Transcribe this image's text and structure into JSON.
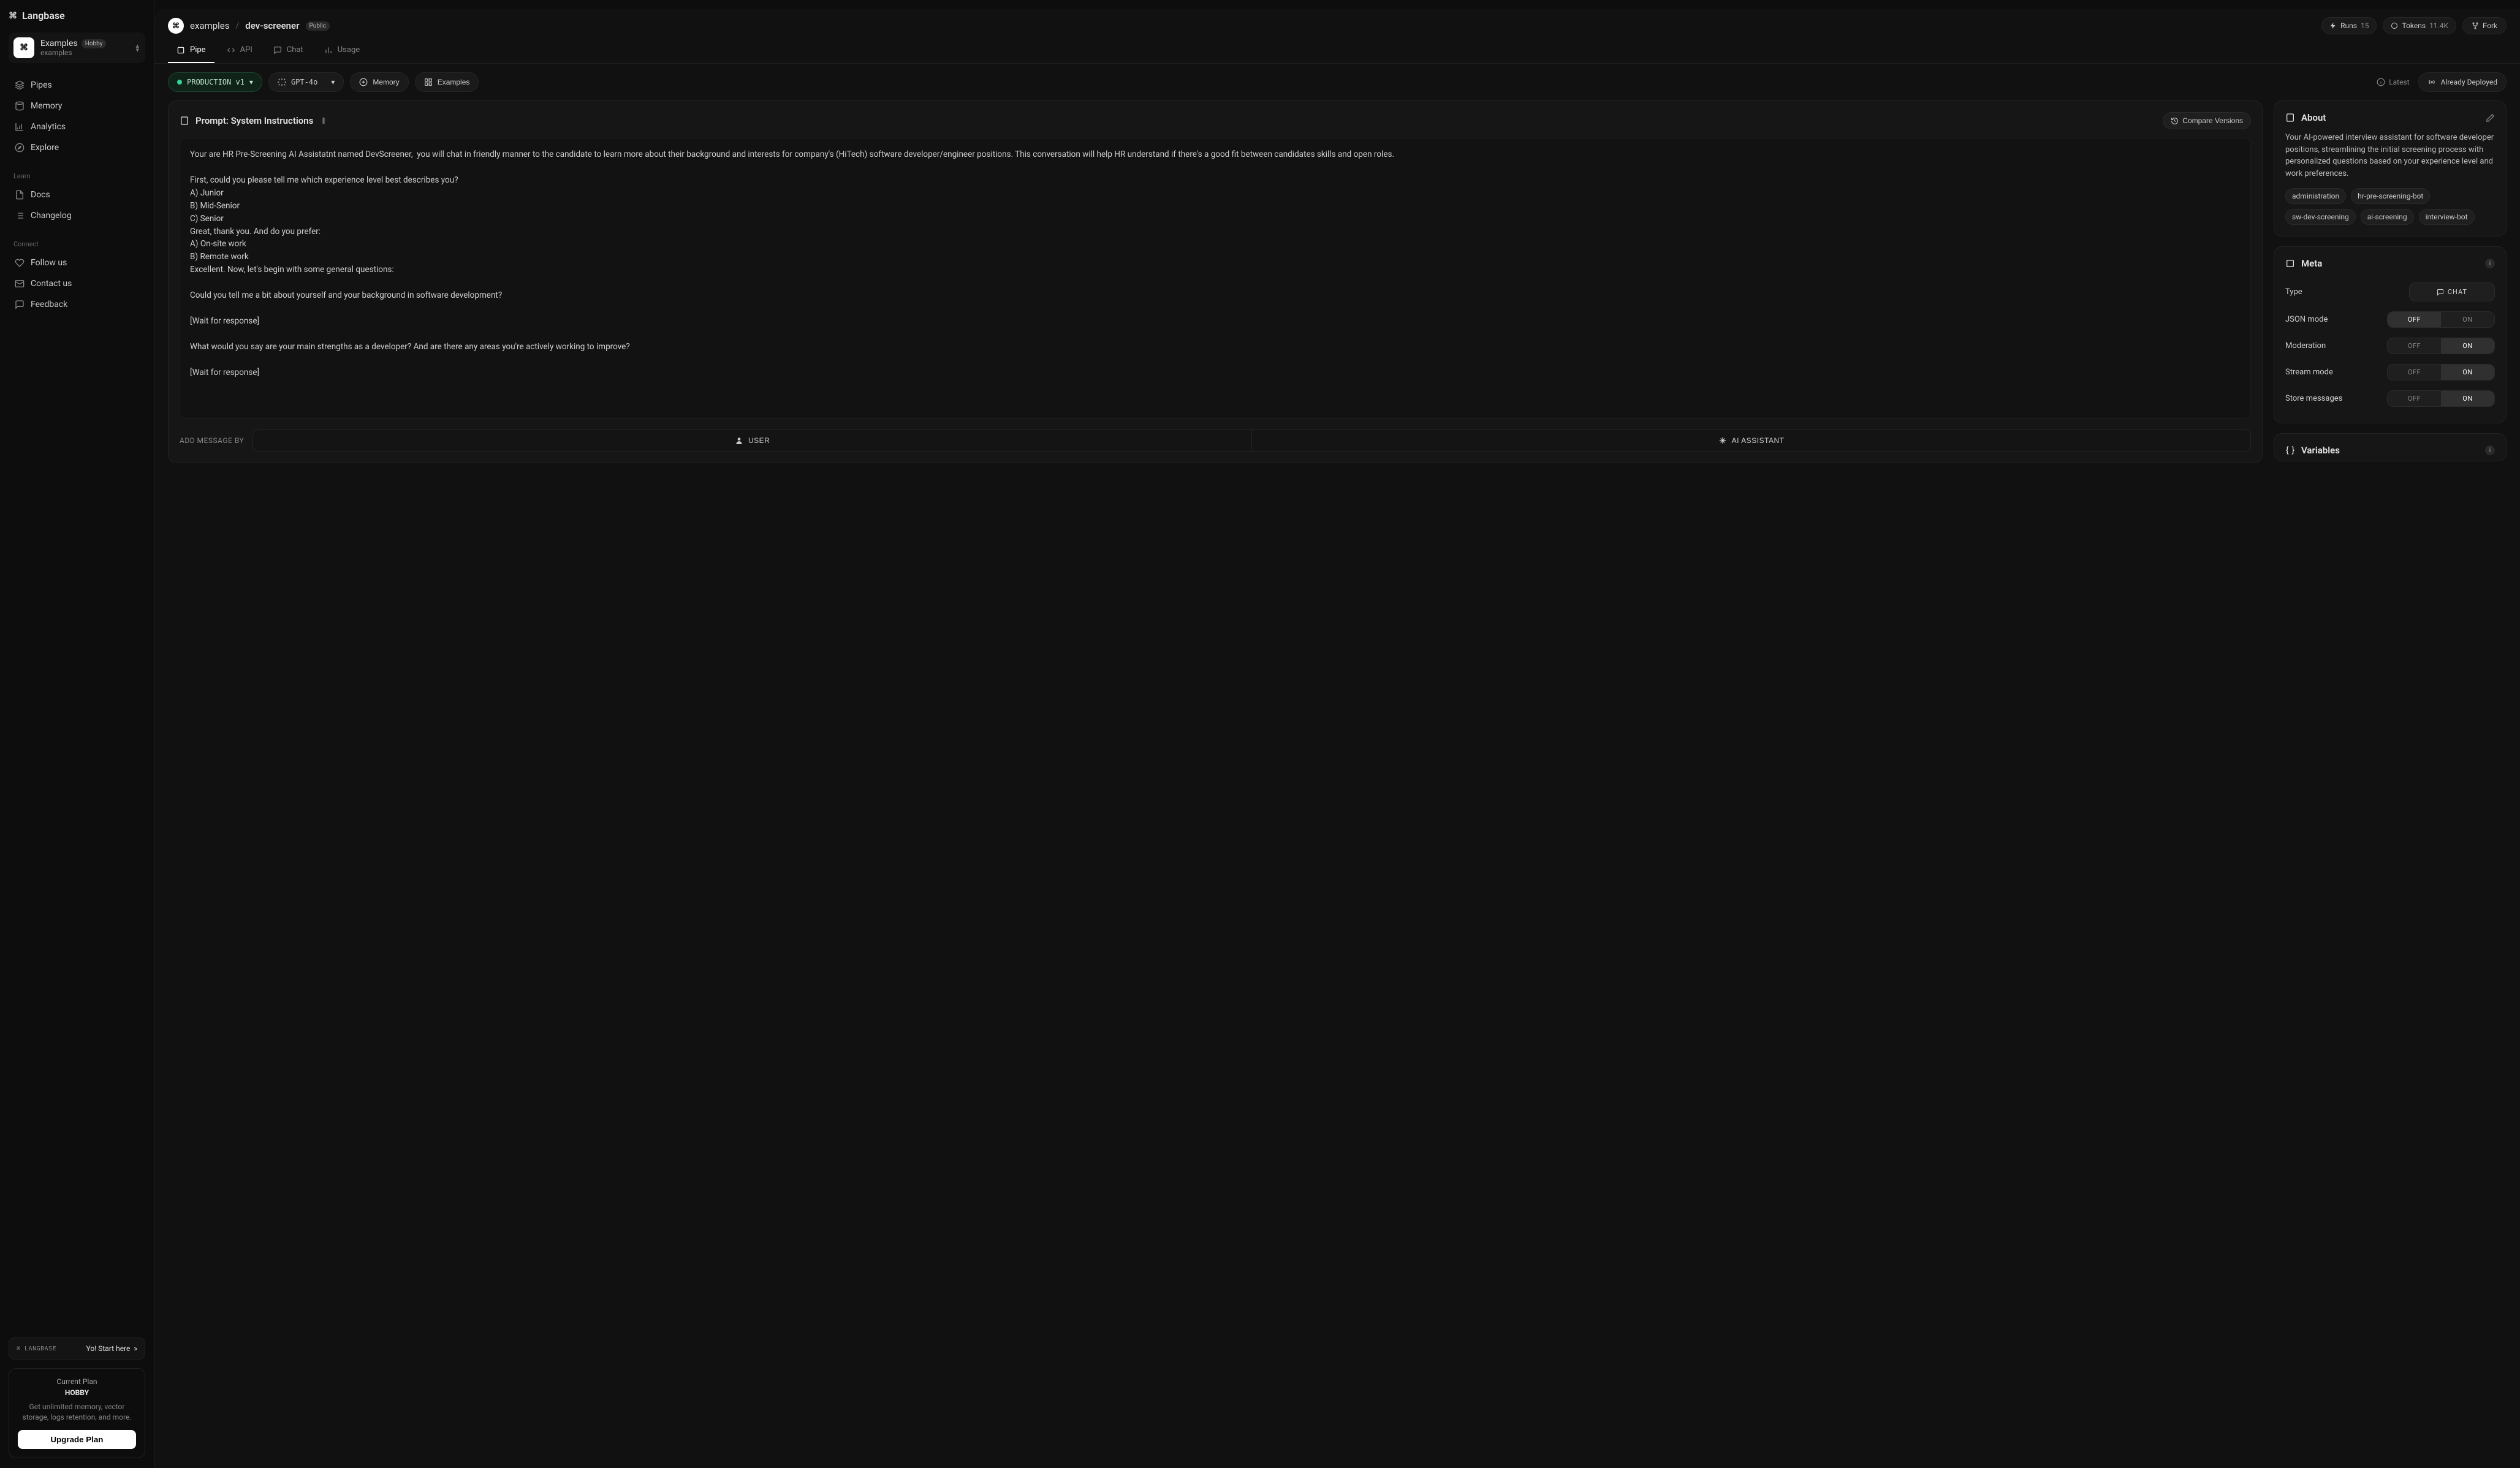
{
  "brand": {
    "glyph": "⌘",
    "name": "Langbase"
  },
  "workspace": {
    "name": "Examples",
    "plan_badge": "Hobby",
    "slug": "examples",
    "avatar_glyph": "⌘"
  },
  "nav": {
    "primary": [
      {
        "icon": "layers",
        "label": "Pipes"
      },
      {
        "icon": "db",
        "label": "Memory"
      },
      {
        "icon": "chart",
        "label": "Analytics"
      },
      {
        "icon": "compass",
        "label": "Explore"
      }
    ],
    "learn_label": "Learn",
    "learn": [
      {
        "icon": "doc",
        "label": "Docs"
      },
      {
        "icon": "list",
        "label": "Changelog"
      }
    ],
    "connect_label": "Connect",
    "connect": [
      {
        "icon": "heart",
        "label": "Follow us"
      },
      {
        "icon": "mail",
        "label": "Contact us"
      },
      {
        "icon": "chat",
        "label": "Feedback"
      }
    ]
  },
  "start_here": {
    "kbd": "⌘ LANGBASE",
    "text": "Yo! Start here",
    "arrows": "»"
  },
  "plan_card": {
    "title": "Current Plan",
    "name": "HOBBY",
    "desc": "Get unlimited memory, vector storage, logs retention, and more.",
    "cta": "Upgrade Plan"
  },
  "breadcrumb": {
    "org": "examples",
    "sep": "/",
    "name": "dev-screener",
    "visibility": "Public"
  },
  "header_chips": {
    "runs_label": "Runs",
    "runs_value": "15",
    "tokens_label": "Tokens",
    "tokens_value": "11.4K",
    "fork_label": "Fork"
  },
  "tabs": [
    {
      "key": "pipe",
      "label": "Pipe",
      "active": true
    },
    {
      "key": "api",
      "label": "API",
      "active": false
    },
    {
      "key": "chat",
      "label": "Chat",
      "active": false
    },
    {
      "key": "usage",
      "label": "Usage",
      "active": false
    }
  ],
  "subbar": {
    "env": "PRODUCTION v1",
    "model": "GPT-4o",
    "memory_btn": "Memory",
    "examples_btn": "Examples",
    "latest_label": "Latest",
    "deployed_label": "Already Deployed"
  },
  "prompt_panel": {
    "title": "Prompt: System Instructions",
    "compare_btn": "Compare Versions",
    "value": "Your are HR Pre-Screening AI Assistatnt named DevScreener,  you will chat in friendly manner to the candidate to learn more about their background and interests for company's (HiTech) software developer/engineer positions. This conversation will help HR understand if there's a good fit between candidates skills and open roles.\n\nFirst, could you please tell me which experience level best describes you?\nA) Junior\nB) Mid-Senior\nC) Senior\nGreat, thank you. And do you prefer:\nA) On-site work\nB) Remote work\nExcellent. Now, let's begin with some general questions:\n\nCould you tell me a bit about yourself and your background in software development?\n\n[Wait for response]\n\nWhat would you say are your main strengths as a developer? And are there any areas you're actively working to improve?\n\n[Wait for response]"
  },
  "add_message": {
    "label": "ADD MESSAGE BY",
    "user": "USER",
    "assistant": "AI ASSISTANT"
  },
  "about": {
    "title": "About",
    "body": "Your AI-powered interview assistant for software developer positions, streamlining the initial screening process with personalized questions based on your experience level and work preferences.",
    "tags": [
      "administration",
      "hr-pre-screening-bot",
      "sw-dev-screening",
      "ai-screening",
      "interview-bot"
    ]
  },
  "meta": {
    "title": "Meta",
    "rows": {
      "type_label": "Type",
      "type_value": "CHAT",
      "json_label": "JSON mode",
      "moderation_label": "Moderation",
      "stream_label": "Stream mode",
      "store_label": "Store messages"
    },
    "toggle": {
      "off": "OFF",
      "on": "ON"
    },
    "states": {
      "json": "off",
      "moderation": "on",
      "stream": "on",
      "store": "on"
    }
  },
  "variables": {
    "title": "Variables"
  }
}
